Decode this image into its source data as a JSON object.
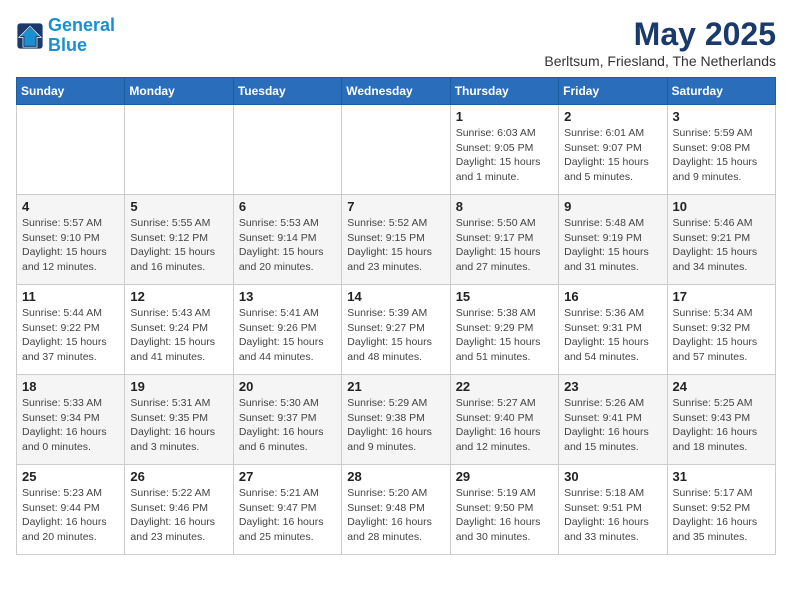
{
  "logo": {
    "line1": "General",
    "line2": "Blue"
  },
  "title": "May 2025",
  "subtitle": "Berltsum, Friesland, The Netherlands",
  "weekdays": [
    "Sunday",
    "Monday",
    "Tuesday",
    "Wednesday",
    "Thursday",
    "Friday",
    "Saturday"
  ],
  "weeks": [
    [
      {
        "day": "",
        "info": ""
      },
      {
        "day": "",
        "info": ""
      },
      {
        "day": "",
        "info": ""
      },
      {
        "day": "",
        "info": ""
      },
      {
        "day": "1",
        "info": "Sunrise: 6:03 AM\nSunset: 9:05 PM\nDaylight: 15 hours\nand 1 minute."
      },
      {
        "day": "2",
        "info": "Sunrise: 6:01 AM\nSunset: 9:07 PM\nDaylight: 15 hours\nand 5 minutes."
      },
      {
        "day": "3",
        "info": "Sunrise: 5:59 AM\nSunset: 9:08 PM\nDaylight: 15 hours\nand 9 minutes."
      }
    ],
    [
      {
        "day": "4",
        "info": "Sunrise: 5:57 AM\nSunset: 9:10 PM\nDaylight: 15 hours\nand 12 minutes."
      },
      {
        "day": "5",
        "info": "Sunrise: 5:55 AM\nSunset: 9:12 PM\nDaylight: 15 hours\nand 16 minutes."
      },
      {
        "day": "6",
        "info": "Sunrise: 5:53 AM\nSunset: 9:14 PM\nDaylight: 15 hours\nand 20 minutes."
      },
      {
        "day": "7",
        "info": "Sunrise: 5:52 AM\nSunset: 9:15 PM\nDaylight: 15 hours\nand 23 minutes."
      },
      {
        "day": "8",
        "info": "Sunrise: 5:50 AM\nSunset: 9:17 PM\nDaylight: 15 hours\nand 27 minutes."
      },
      {
        "day": "9",
        "info": "Sunrise: 5:48 AM\nSunset: 9:19 PM\nDaylight: 15 hours\nand 31 minutes."
      },
      {
        "day": "10",
        "info": "Sunrise: 5:46 AM\nSunset: 9:21 PM\nDaylight: 15 hours\nand 34 minutes."
      }
    ],
    [
      {
        "day": "11",
        "info": "Sunrise: 5:44 AM\nSunset: 9:22 PM\nDaylight: 15 hours\nand 37 minutes."
      },
      {
        "day": "12",
        "info": "Sunrise: 5:43 AM\nSunset: 9:24 PM\nDaylight: 15 hours\nand 41 minutes."
      },
      {
        "day": "13",
        "info": "Sunrise: 5:41 AM\nSunset: 9:26 PM\nDaylight: 15 hours\nand 44 minutes."
      },
      {
        "day": "14",
        "info": "Sunrise: 5:39 AM\nSunset: 9:27 PM\nDaylight: 15 hours\nand 48 minutes."
      },
      {
        "day": "15",
        "info": "Sunrise: 5:38 AM\nSunset: 9:29 PM\nDaylight: 15 hours\nand 51 minutes."
      },
      {
        "day": "16",
        "info": "Sunrise: 5:36 AM\nSunset: 9:31 PM\nDaylight: 15 hours\nand 54 minutes."
      },
      {
        "day": "17",
        "info": "Sunrise: 5:34 AM\nSunset: 9:32 PM\nDaylight: 15 hours\nand 57 minutes."
      }
    ],
    [
      {
        "day": "18",
        "info": "Sunrise: 5:33 AM\nSunset: 9:34 PM\nDaylight: 16 hours\nand 0 minutes."
      },
      {
        "day": "19",
        "info": "Sunrise: 5:31 AM\nSunset: 9:35 PM\nDaylight: 16 hours\nand 3 minutes."
      },
      {
        "day": "20",
        "info": "Sunrise: 5:30 AM\nSunset: 9:37 PM\nDaylight: 16 hours\nand 6 minutes."
      },
      {
        "day": "21",
        "info": "Sunrise: 5:29 AM\nSunset: 9:38 PM\nDaylight: 16 hours\nand 9 minutes."
      },
      {
        "day": "22",
        "info": "Sunrise: 5:27 AM\nSunset: 9:40 PM\nDaylight: 16 hours\nand 12 minutes."
      },
      {
        "day": "23",
        "info": "Sunrise: 5:26 AM\nSunset: 9:41 PM\nDaylight: 16 hours\nand 15 minutes."
      },
      {
        "day": "24",
        "info": "Sunrise: 5:25 AM\nSunset: 9:43 PM\nDaylight: 16 hours\nand 18 minutes."
      }
    ],
    [
      {
        "day": "25",
        "info": "Sunrise: 5:23 AM\nSunset: 9:44 PM\nDaylight: 16 hours\nand 20 minutes."
      },
      {
        "day": "26",
        "info": "Sunrise: 5:22 AM\nSunset: 9:46 PM\nDaylight: 16 hours\nand 23 minutes."
      },
      {
        "day": "27",
        "info": "Sunrise: 5:21 AM\nSunset: 9:47 PM\nDaylight: 16 hours\nand 25 minutes."
      },
      {
        "day": "28",
        "info": "Sunrise: 5:20 AM\nSunset: 9:48 PM\nDaylight: 16 hours\nand 28 minutes."
      },
      {
        "day": "29",
        "info": "Sunrise: 5:19 AM\nSunset: 9:50 PM\nDaylight: 16 hours\nand 30 minutes."
      },
      {
        "day": "30",
        "info": "Sunrise: 5:18 AM\nSunset: 9:51 PM\nDaylight: 16 hours\nand 33 minutes."
      },
      {
        "day": "31",
        "info": "Sunrise: 5:17 AM\nSunset: 9:52 PM\nDaylight: 16 hours\nand 35 minutes."
      }
    ]
  ]
}
